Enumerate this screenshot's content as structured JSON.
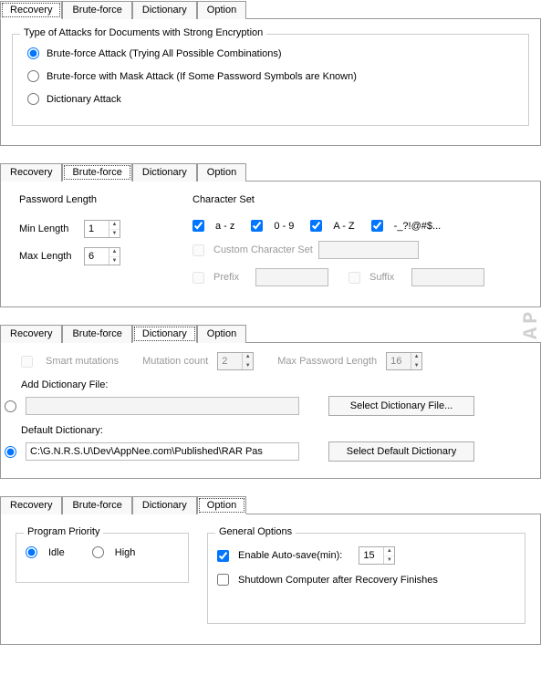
{
  "watermark": "APPNEE.COM",
  "tabs": {
    "recovery": "Recovery",
    "bruteforce": "Brute-force",
    "dictionary": "Dictionary",
    "option": "Option"
  },
  "panel1": {
    "group_title": "Type of Attacks for Documents with Strong Encryption",
    "opt1": "Brute-force Attack (Trying All Possible Combinations)",
    "opt2": "Brute-force with Mask Attack (If Some Password Symbols are Known)",
    "opt3": "Dictionary Attack"
  },
  "panel2": {
    "pwd_len_title": "Password Length",
    "min_label": "Min Length",
    "min_value": "1",
    "max_label": "Max Length",
    "max_value": "6",
    "charset_title": "Character Set",
    "cs1": "a - z",
    "cs2": "0 - 9",
    "cs3": "A - Z",
    "cs4": "-_?!@#$...",
    "custom_cs": "Custom Character Set",
    "prefix": "Prefix",
    "suffix": "Suffix"
  },
  "panel3": {
    "smart": "Smart mutations",
    "mutcount_label": "Mutation count",
    "mutcount": "2",
    "maxlen_label": "Max Password Length",
    "maxlen": "16",
    "add_label": "Add Dictionary File:",
    "select_file_btn": "Select Dictionary File...",
    "default_label": "Default Dictionary:",
    "default_path": "C:\\G.N.R.S.U\\Dev\\AppNee.com\\Published\\RAR Pas",
    "select_default_btn": "Select Default Dictionary"
  },
  "panel4": {
    "priority_title": "Program Priority",
    "idle": "Idle",
    "high": "High",
    "general_title": "General Options",
    "autosave": "Enable Auto-save(min):",
    "autosave_val": "15",
    "shutdown": "Shutdown Computer after Recovery Finishes"
  }
}
